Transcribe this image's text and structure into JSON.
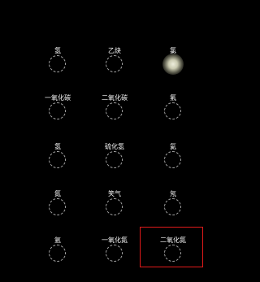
{
  "gases": [
    {
      "label": "氢"
    },
    {
      "label": "乙炔"
    },
    {
      "label": "氯"
    },
    {
      "label": "一氧化碳"
    },
    {
      "label": "二氧化碳"
    },
    {
      "label": "氟"
    },
    {
      "label": "氢"
    },
    {
      "label": "硫化氢"
    },
    {
      "label": "氦"
    },
    {
      "label": "氮"
    },
    {
      "label": "笑气"
    },
    {
      "label": "氖"
    },
    {
      "label": "氩"
    },
    {
      "label": "一氧化氮"
    },
    {
      "label": "二氧化氮"
    }
  ],
  "selected_label": "二氧化氮",
  "accent_color": "#e11a1a"
}
